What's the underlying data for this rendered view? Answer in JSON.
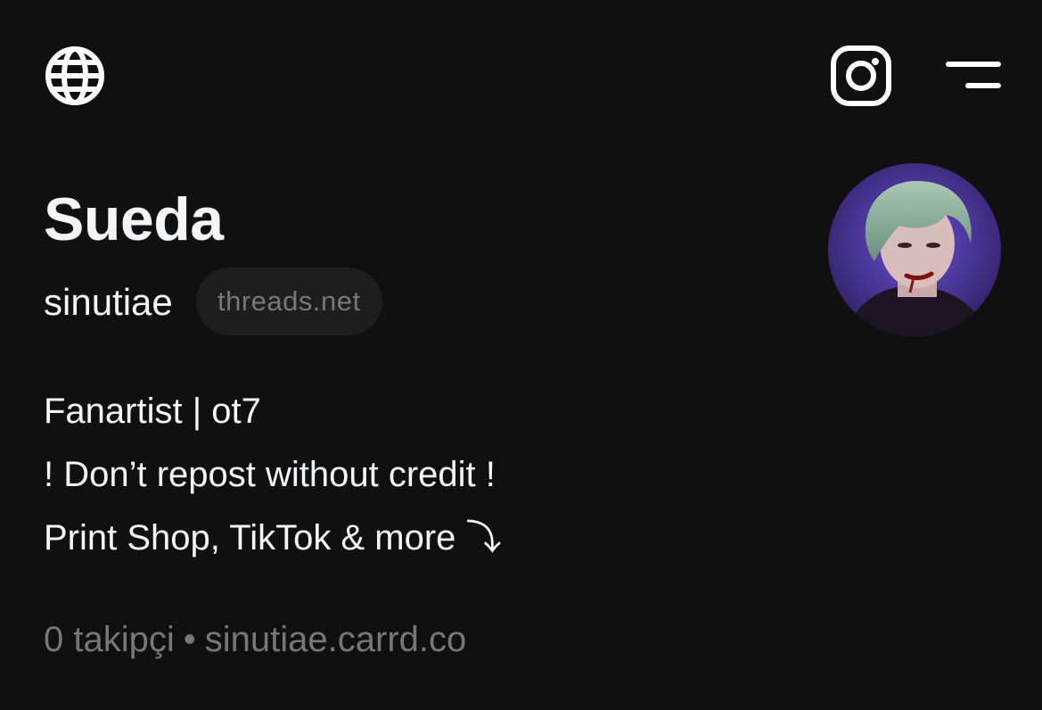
{
  "header": {
    "left_icon": "globe-icon",
    "right_icons": [
      "instagram-icon",
      "menu-icon"
    ]
  },
  "profile": {
    "name": "Sueda",
    "handle": "sinutiae",
    "domain_badge": "threads.net",
    "avatar": "profile-avatar"
  },
  "bio": {
    "line1": "Fanartist | ot7",
    "line2": "! Don’t repost without credit !",
    "line3": "Print Shop, TikTok & more ⤵"
  },
  "footer": {
    "followers": "0 takipçi",
    "separator": "•",
    "link": "sinutiae.carrd.co"
  },
  "colors": {
    "background": "#101010",
    "primary_text": "#f3f5f7",
    "secondary_text": "#777777",
    "badge_background": "#1e1e1e"
  }
}
